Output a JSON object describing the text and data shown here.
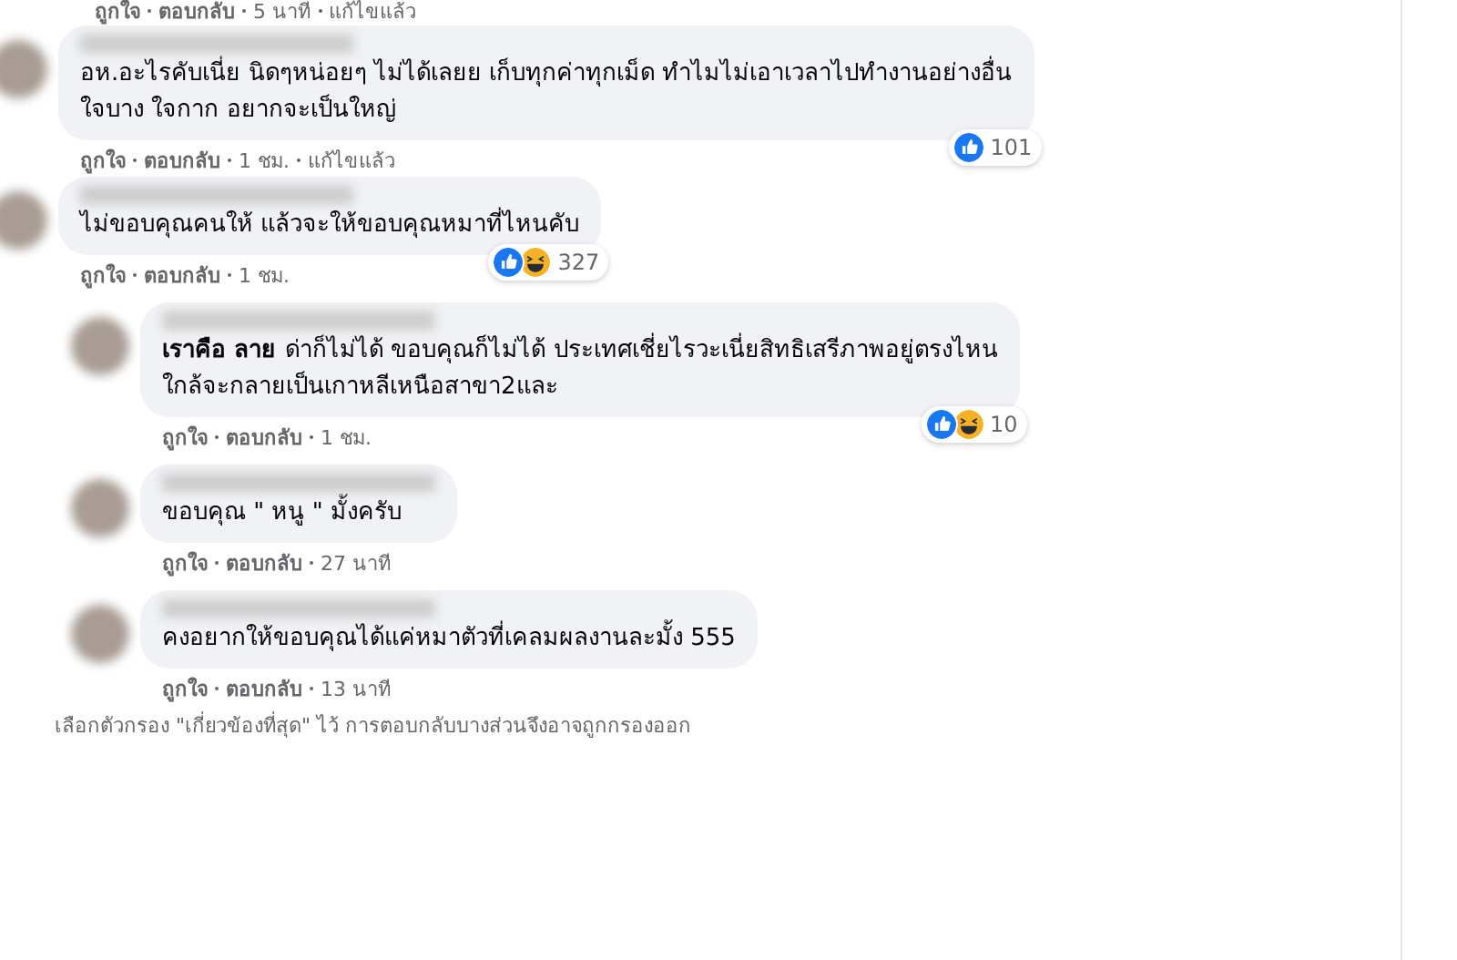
{
  "top_actions": [
    "ถูกใจ",
    "ตอบกลับ",
    "5 นาที",
    "แก้ไขแล้ว"
  ],
  "comments": [
    {
      "reply": false,
      "lines": [
        "อห.อะไรคับเนี่ย นิดๆหน่อยๆ ไม่ได้เลยย เก็บทุกค่าทุกเม็ด ทำไมไม่เอาเวลาไปทำงานอย่างอื่น",
        "ใจบาง ใจกาก อยากจะเป็นใหญ่"
      ],
      "actions": [
        "ถูกใจ",
        "ตอบกลับ",
        "1 ชม.",
        "แก้ไขแล้ว"
      ],
      "reactions": {
        "icons": [
          {
            "kind": "like"
          }
        ],
        "count": "101"
      }
    },
    {
      "reply": false,
      "lines": [
        "ไม่ขอบคุณคนให้ แล้วจะให้ขอบคุณหมาที่ไหนคับ"
      ],
      "actions": [
        "ถูกใจ",
        "ตอบกลับ",
        "1 ชม."
      ],
      "reactions": {
        "icons": [
          {
            "kind": "like"
          },
          {
            "kind": "haha"
          }
        ],
        "count": "327"
      }
    },
    {
      "reply": true,
      "mention": "เราคือ ลาย",
      "lines": [
        "ด่าก็ไม่ได้ ขอบคุณก็ไม่ได้ ประเทศเชี่ยไรวะเนี่ยสิทธิเสรีภาพอยู่ตรงไหน",
        "ใกล้จะกลายเป็นเกาหลีเหนือสาขา2และ"
      ],
      "actions": [
        "ถูกใจ",
        "ตอบกลับ",
        "1 ชม."
      ],
      "reactions": {
        "icons": [
          {
            "kind": "like"
          },
          {
            "kind": "haha"
          }
        ],
        "count": "10"
      }
    },
    {
      "reply": true,
      "lines": [
        "ขอบคุณ \" หนู \" มั้งครับ"
      ],
      "actions": [
        "ถูกใจ",
        "ตอบกลับ",
        "27 นาที"
      ]
    },
    {
      "reply": true,
      "lines": [
        "คงอยากให้ขอบคุณได้แค่หมาตัวที่เคลมผลงานละมั้ง 555"
      ],
      "actions": [
        "ถูกใจ",
        "ตอบกลับ",
        "13 นาที"
      ]
    }
  ],
  "footer_note": "เลือกตัวกรอง \"เกี่ยวข้องที่สุด\" ไว้ การตอบกลับบางส่วนจึงอาจถูกกรองออก"
}
